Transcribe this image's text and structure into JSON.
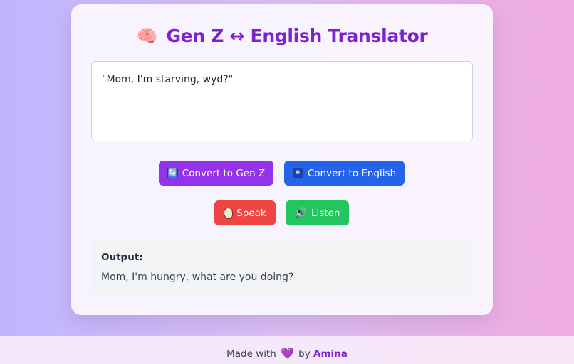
{
  "app": {
    "title_emoji": "🧠",
    "title": "Gen Z ↔ English Translator"
  },
  "input": {
    "value": "\"Mom, I'm starving, wyd?\""
  },
  "buttons": {
    "genz": {
      "icon": "🔄",
      "label": "Convert to Gen Z"
    },
    "english": {
      "icon": "🔤",
      "label": "Convert to English"
    },
    "speak": {
      "icon": "ear-icon",
      "label": "Speak"
    },
    "listen": {
      "icon": "🔊",
      "label": "Listen"
    }
  },
  "output": {
    "label": "Output:",
    "text": "Mom, I'm hungry, what are you doing?"
  },
  "footer": {
    "prefix": "Made with",
    "heart": "💜",
    "by": "by",
    "author": "Amina"
  },
  "colors": {
    "title": "#7e22ce",
    "genz_button": "#9333ea",
    "english_button": "#2563eb",
    "speak_button": "#ef4444",
    "listen_button": "#22c55e"
  }
}
